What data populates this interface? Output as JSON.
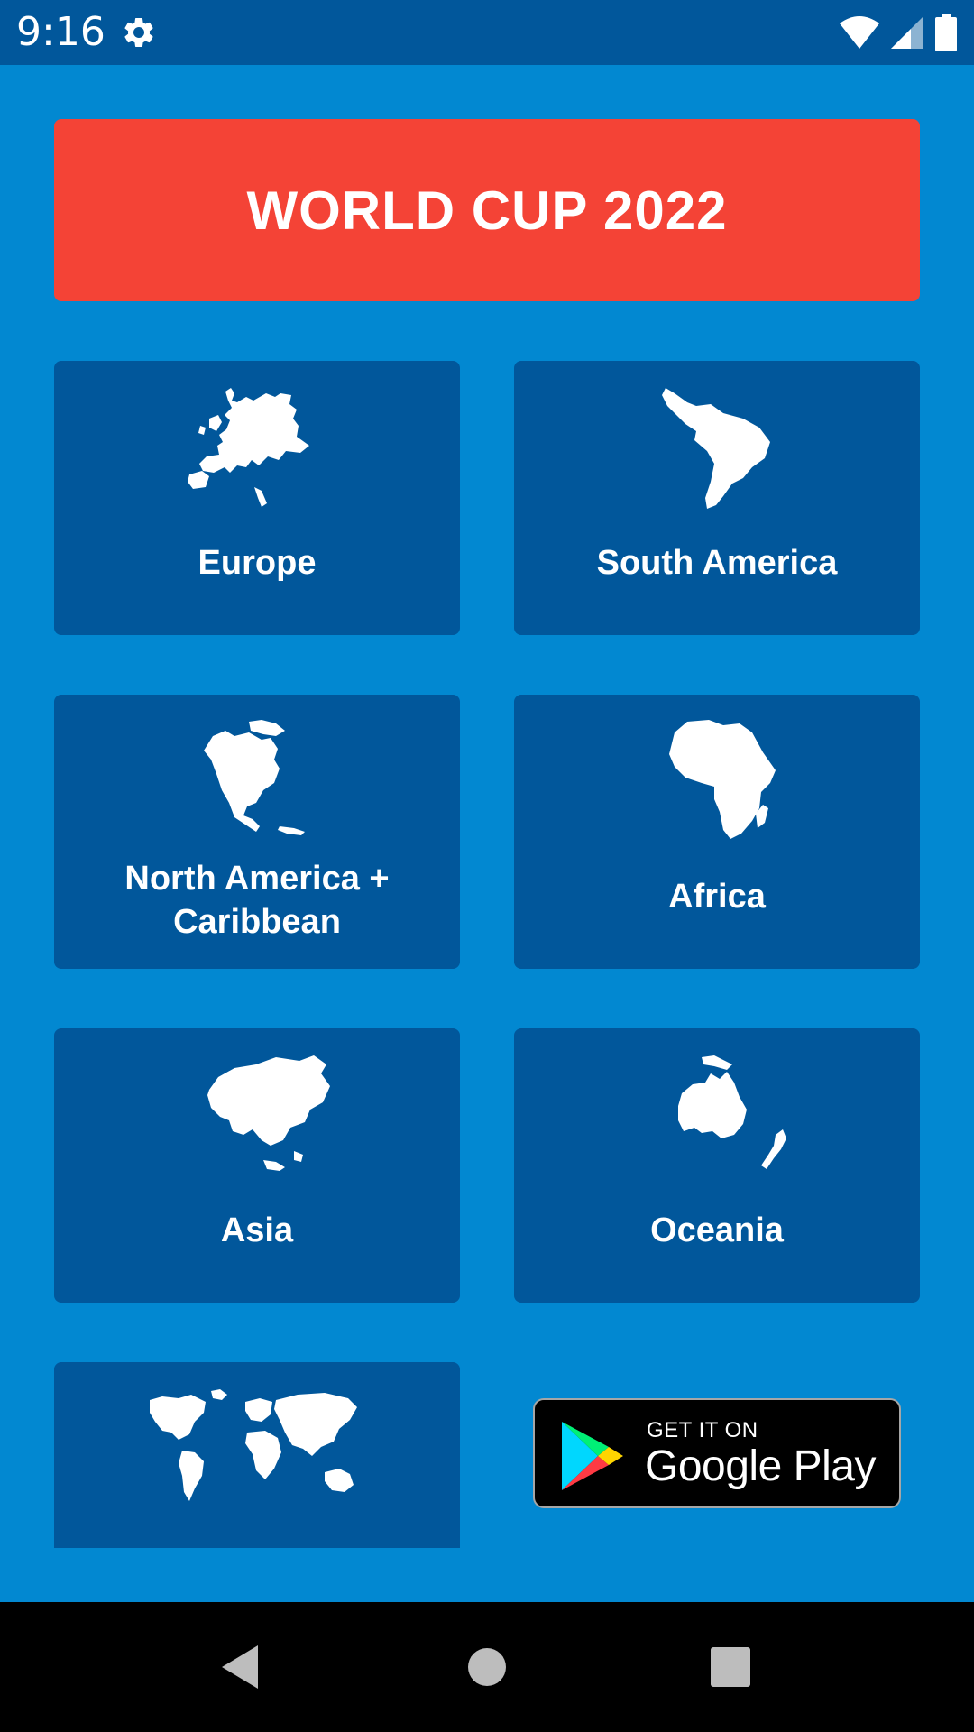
{
  "status_bar": {
    "time": "9:16",
    "icons": [
      "settings-gear-icon",
      "wifi-icon",
      "cell-signal-icon",
      "battery-icon"
    ]
  },
  "title": "WORLD CUP 2022",
  "continents": [
    {
      "label": "Europe",
      "icon": "europe-map-icon"
    },
    {
      "label": "South America",
      "icon": "south-america-map-icon"
    },
    {
      "label": "North America +\nCaribbean",
      "icon": "north-america-map-icon"
    },
    {
      "label": "Africa",
      "icon": "africa-map-icon"
    },
    {
      "label": "Asia",
      "icon": "asia-map-icon"
    },
    {
      "label": "Oceania",
      "icon": "oceania-map-icon"
    },
    {
      "label": "",
      "icon": "world-map-icon"
    }
  ],
  "play_badge": {
    "small_text": "GET IT ON",
    "big_text": "Google Play"
  },
  "nav_bar": {
    "icons": [
      "back-icon",
      "home-icon",
      "recents-icon"
    ]
  },
  "colors": {
    "background": "#0288D1",
    "status_bar": "#01579B",
    "card": "#01579B",
    "banner": "#F44336",
    "nav_bar": "#000000"
  }
}
